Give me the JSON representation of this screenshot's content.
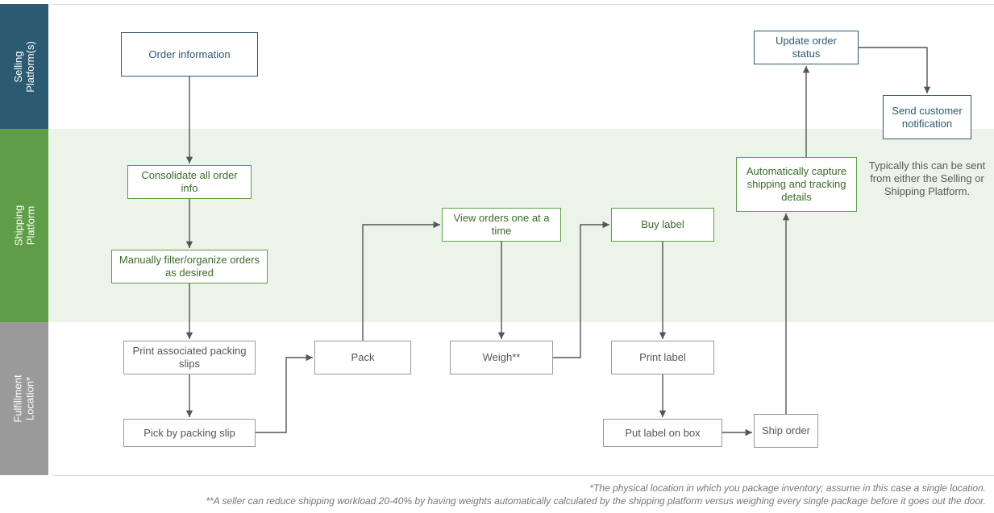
{
  "lanes": {
    "selling": "Selling\nPlatform(s)",
    "shipping": "Shipping\nPlatform",
    "fulfillment": "Fulfillment\nLocation*"
  },
  "boxes": {
    "order_info": "Order information",
    "consolidate": "Consolidate all order info",
    "filter": "Manually filter/organize orders as desired",
    "print_slips": "Print associated packing slips",
    "pick": "Pick by packing slip",
    "pack": "Pack",
    "view_orders": "View orders one at a time",
    "weigh": "Weigh**",
    "buy_label": "Buy label",
    "print_label": "Print label",
    "put_label": "Put label on box",
    "ship": "Ship order",
    "capture": "Automatically capture shipping and tracking details",
    "update": "Update order status",
    "notify": "Send customer notification"
  },
  "note_right": "Typically this can be sent from either the Selling or Shipping Platform.",
  "footnotes": {
    "a": "*The physical location in which you package inventory; assume in this case a single location.",
    "b": "**A seller can reduce shipping workload 20-40% by having weights automatically calculated by the shipping platform versus weighing every single package before it goes out the door."
  }
}
